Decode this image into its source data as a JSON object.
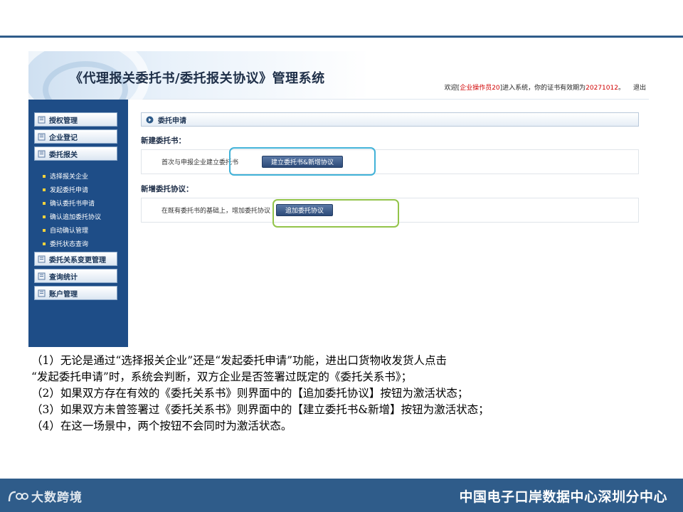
{
  "app": {
    "title": "《代理报关委托书/委托报关协议》管理系统",
    "welcome": {
      "prefix": "欢迎[",
      "user": "企业操作员20",
      "mid": "]进入系统，你的证书有效期为",
      "expiry": "20271012",
      "suffix": "。",
      "logout": "退出"
    }
  },
  "sidebar": {
    "top_items": [
      {
        "label": "授权管理"
      },
      {
        "label": "企业登记"
      },
      {
        "label": "委托报关"
      }
    ],
    "sub_items": [
      {
        "label": "选择报关企业"
      },
      {
        "label": "发起委托申请"
      },
      {
        "label": "确认委托书申请"
      },
      {
        "label": "确认追加委托协议"
      },
      {
        "label": "自动确认管理"
      },
      {
        "label": "委托状态查询"
      }
    ],
    "bottom_items": [
      {
        "label": "委托关系变更管理"
      },
      {
        "label": "查询统计"
      },
      {
        "label": "账户管理"
      }
    ]
  },
  "main": {
    "section_title": "委托申请",
    "new_book": {
      "heading": "新建委托书：",
      "text": "首次与申报企业建立委托书",
      "button": "建立委托书&新增协议"
    },
    "add_agreement": {
      "heading": "新增委托协议：",
      "text": "在既有委托书的基础上，增加委托协议",
      "button": "追加委托协议"
    }
  },
  "notes": [
    "（1）无论是通过“选择报关企业”还是“发起委托申请”功能，进出口货物收发货人点击",
    "“发起委托申请”时，系统会判断，双方企业是否签署过既定的《委托关系书》；",
    "（2）如果双方存在有效的《委托关系书》则界面中的【追加委托协议】按钮为激活状态；",
    "（3）如果双方未曾签署过《委托关系书》则界面中的【建立委托书&新增】按钮为激活状态；",
    "（4）在这一场景中，两个按钮不会同时为激活状态。"
  ],
  "footer": {
    "logo_text": "大数跨境",
    "org": "中国电子口岸数据中心深圳分中心"
  },
  "colors": {
    "brand_blue": "#2f5c8a",
    "sidebar_blue": "#1e4d87",
    "highlight_blue": "#41b2d8",
    "highlight_green": "#93c44a",
    "alert_red": "#d00000"
  },
  "icons": [
    "book-icon",
    "circle-arrow-icon",
    "bullet-icon",
    "logo-icon"
  ]
}
